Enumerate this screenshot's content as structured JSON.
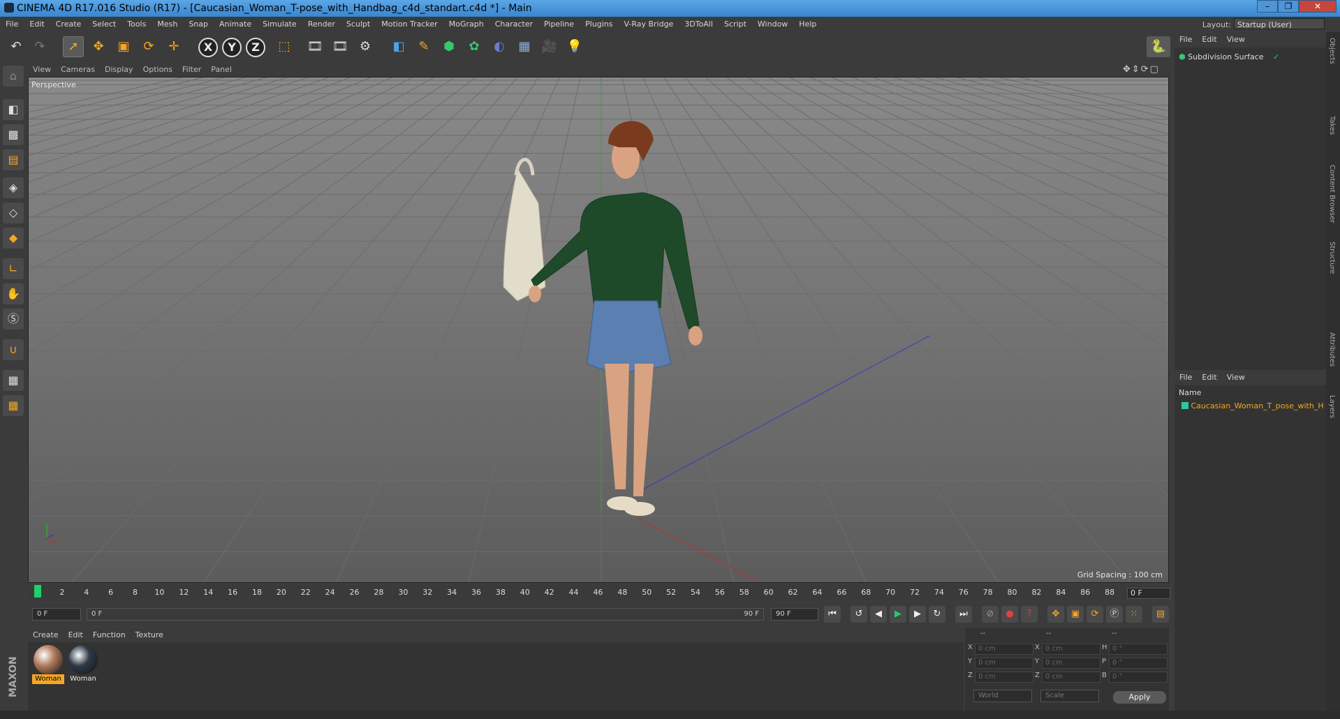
{
  "window": {
    "title": "CINEMA 4D R17.016 Studio (R17) - [Caucasian_Woman_T-pose_with_Handbag_c4d_standart.c4d *] - Main",
    "minimize": "–",
    "maximize": "❐",
    "close": "✕"
  },
  "menubar": [
    "File",
    "Edit",
    "Create",
    "Select",
    "Tools",
    "Mesh",
    "Snap",
    "Animate",
    "Simulate",
    "Render",
    "Sculpt",
    "Motion Tracker",
    "MoGraph",
    "Character",
    "Pipeline",
    "Plugins",
    "V-Ray Bridge",
    "3DToAll",
    "Script",
    "Window",
    "Help"
  ],
  "layout": {
    "label": "Layout:",
    "value": "Startup (User)"
  },
  "toolbar": {
    "axis_x": "X",
    "axis_y": "Y",
    "axis_z": "Z"
  },
  "viewport": {
    "menu": [
      "View",
      "Cameras",
      "Display",
      "Options",
      "Filter",
      "Panel"
    ],
    "camera_label": "Perspective",
    "grid_spacing": "Grid Spacing : 100 cm"
  },
  "timeline": {
    "ticks": [
      "0",
      "2",
      "4",
      "6",
      "8",
      "10",
      "12",
      "14",
      "16",
      "18",
      "20",
      "22",
      "24",
      "26",
      "28",
      "30",
      "32",
      "34",
      "36",
      "38",
      "40",
      "42",
      "44",
      "46",
      "48",
      "50",
      "52",
      "54",
      "56",
      "58",
      "60",
      "62",
      "64",
      "66",
      "68",
      "70",
      "72",
      "74",
      "76",
      "78",
      "80",
      "82",
      "84",
      "86",
      "88",
      "90"
    ],
    "current_frame": "0 F",
    "start_field": "0 F",
    "range_start": "0 F",
    "range_end": "90 F",
    "end_field": "90 F"
  },
  "materials": {
    "menu": [
      "Create",
      "Edit",
      "Function",
      "Texture"
    ],
    "items": [
      {
        "label": "Woman",
        "color": "#b07a5a",
        "selected": true
      },
      {
        "label": "Woman",
        "color": "#2e3a48",
        "selected": false
      }
    ]
  },
  "coords": {
    "header": [
      "--",
      "--",
      "--"
    ],
    "rows": [
      {
        "a": "X",
        "av": "0 cm",
        "b": "X",
        "bv": "0 cm",
        "c": "H",
        "cv": "0 °"
      },
      {
        "a": "Y",
        "av": "0 cm",
        "b": "Y",
        "bv": "0 cm",
        "c": "P",
        "cv": "0 °"
      },
      {
        "a": "Z",
        "av": "0 cm",
        "b": "Z",
        "bv": "0 cm",
        "c": "B",
        "cv": "0 °"
      }
    ],
    "mode1": "World",
    "mode2": "Scale",
    "apply": "Apply"
  },
  "objects": {
    "menu": [
      "File",
      "Edit",
      "View"
    ],
    "items": [
      {
        "name": "Subdivision Surface"
      }
    ]
  },
  "layers": {
    "menu": [
      "File",
      "Edit",
      "View"
    ],
    "column": "Name",
    "items": [
      {
        "name": "Caucasian_Woman_T_pose_with_H"
      }
    ]
  },
  "sidetabs": [
    "Objects",
    "Takes",
    "Content Browser",
    "Structure",
    "Attributes",
    "Layers"
  ],
  "brand": "MAXON CINEMA 4D",
  "colors": {
    "accent": "#f5a623",
    "playhead": "#1fcf6a",
    "layer": "#2ec8a0"
  }
}
